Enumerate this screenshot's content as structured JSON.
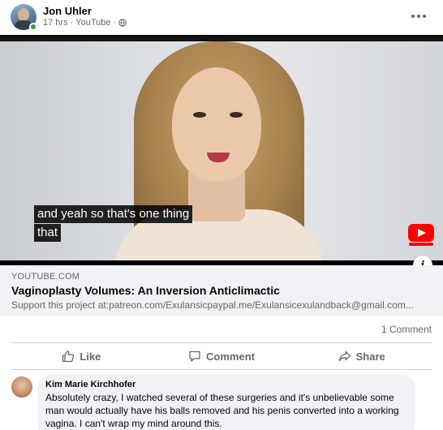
{
  "post": {
    "author": "Jon Uhler",
    "time": "17 hrs",
    "source": "YouTube",
    "separator": "·",
    "privacy_icon": "globe-icon",
    "more_icon": "more-horizontal-icon"
  },
  "video": {
    "captions": [
      "and yeah so that's one thing",
      "that"
    ],
    "badge_icon": "youtube-subscribe-icon",
    "info_icon": "info-icon",
    "info_label": "i"
  },
  "link": {
    "domain": "YOUTUBE.COM",
    "title": "Vaginoplasty Volumes: An Inversion Anticlimactic",
    "description": "Support this project at:patreon.com/Exulansicpaypal.me/Exulansicexulandback@gmail.com..."
  },
  "stats": {
    "comments": "1 Comment"
  },
  "actions": [
    {
      "label": "Like",
      "icon": "thumbs-up-icon"
    },
    {
      "label": "Comment",
      "icon": "comment-icon"
    },
    {
      "label": "Share",
      "icon": "share-icon"
    }
  ],
  "comment": {
    "author": "Kim Marie Kirchhofer",
    "text": "Absolutely crazy, I watched several of these surgeries and it's unbelievable some man would actually have his balls removed and his penis converted into a working vagina. I can't wrap my mind around this."
  },
  "colors": {
    "accent": "#1877f2",
    "muted_text": "#65676b",
    "online": "#31a24c",
    "youtube_red": "#ff0000"
  }
}
